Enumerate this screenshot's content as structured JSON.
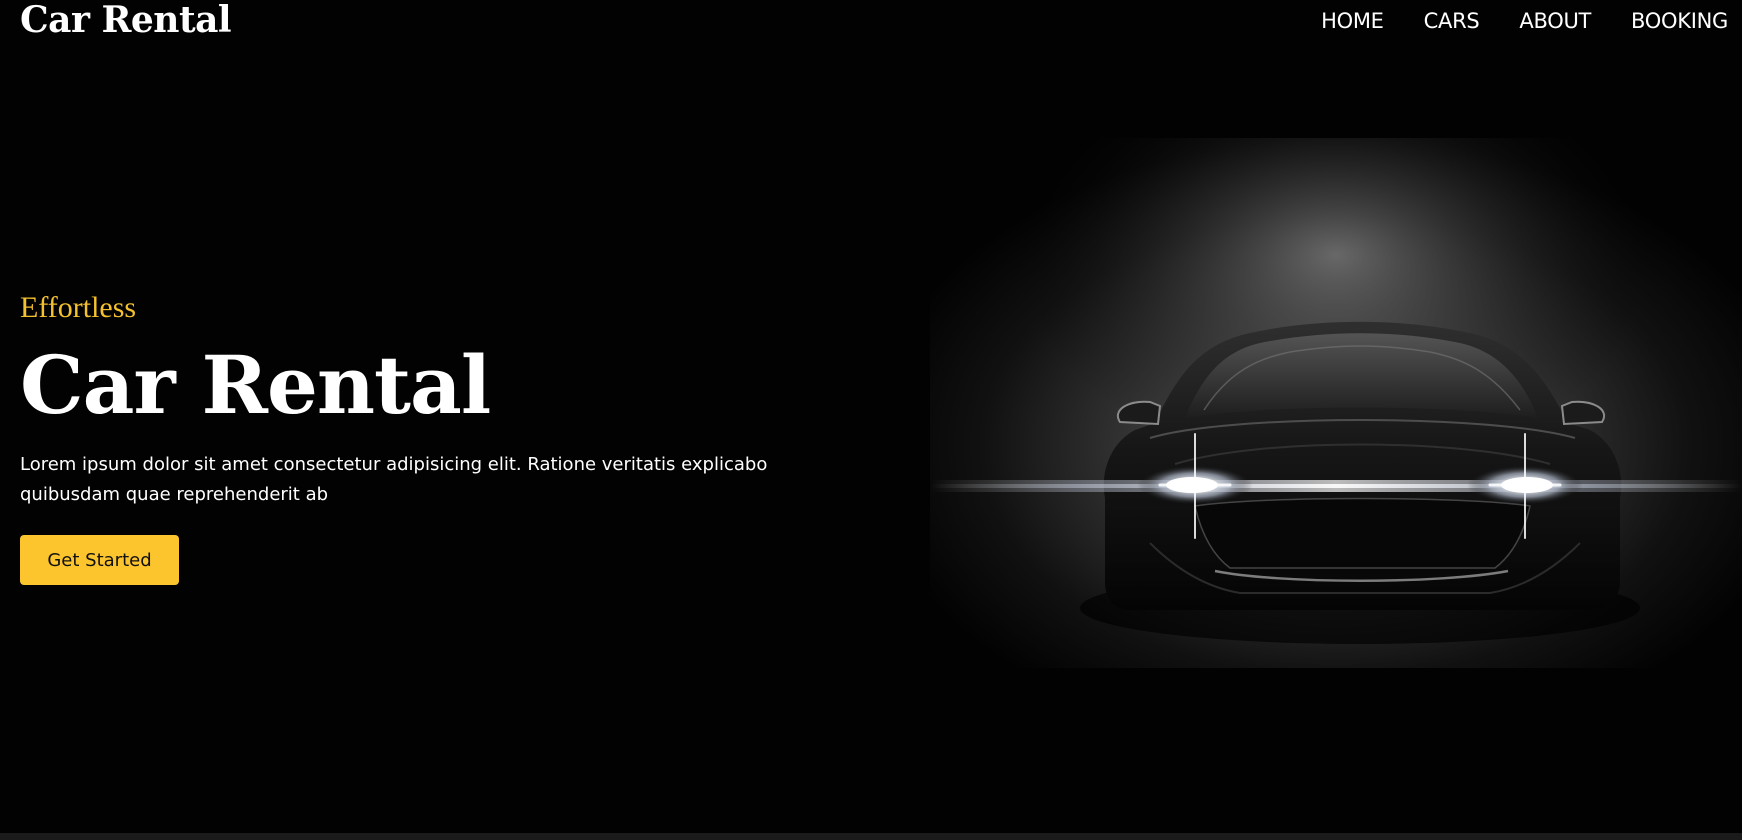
{
  "header": {
    "logo": "Car Rental",
    "nav": [
      "HOME",
      "CARS",
      "ABOUT",
      "BOOKING"
    ]
  },
  "hero": {
    "eyebrow": "Effortless",
    "title": "Car Rental",
    "description": "Lorem ipsum dolor sit amet consectetur adipisicing elit. Ratione veritatis explicabo quibusdam quae reprehenderit ab",
    "cta_label": "Get Started"
  },
  "colors": {
    "accent": "#fcc52e",
    "background": "#020202",
    "text": "#ffffff"
  },
  "icons": {
    "hero_image": "car-headlights-illustration"
  }
}
